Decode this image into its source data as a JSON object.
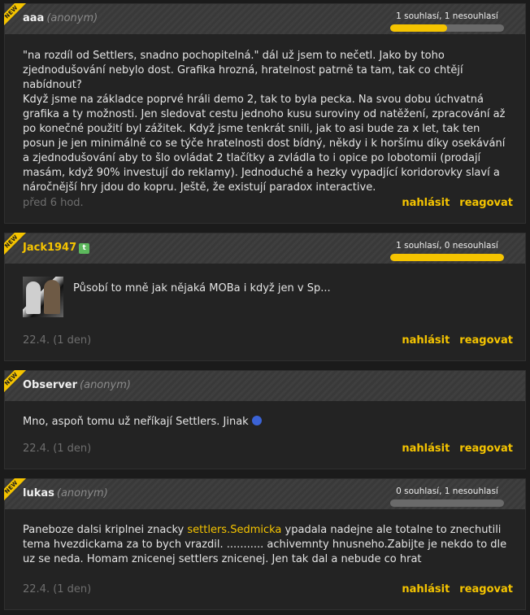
{
  "new_label": "NEW",
  "comments": [
    {
      "name": "aaa",
      "anon": "(anonym)",
      "votes": "1 souhlasí, 1 nesouhlasí",
      "agree_fraction": 0.5,
      "text": "\"na rozdíl od Settlers, snadno pochopitelná.\" dál už jsem to nečetl. Jako by toho zjednodušování nebylo dost. Grafika hrozná, hratelnost patrně ta tam, tak co chtějí nabídnout?\nKdyž jsme na základce poprvé hráli demo 2, tak to byla pecka. Na svou dobu úchvatná grafika a ty možnosti. Jen sledovat cestu jednoho kusu suroviny od natěžení, zpracování až po konečné použití byl zážitek. Když jsme tenkrát snili, jak to asi bude za x let, tak ten posun je jen minimálně co se týče hratelnosti dost bídný, někdy i k horšímu díky osekávání a zjednodušování aby to šlo ovládat 2 tlačítky a zvládla to i opice po lobotomii (prodají masám, když 90% investují do reklamy). Jednoduché a hezky vypadjící koridorovky slaví a náročnější hry jdou do kopru. Ještě, že existují paradox interactive.",
      "date": "před 6 hod.",
      "report": "nahlásit",
      "reply": "reagovat"
    },
    {
      "name": "Jack1947",
      "badge": "t",
      "votes": "1 souhlasí, 0 nesouhlasí",
      "agree_fraction": 1.0,
      "text": "Působí to mně jak nějaká MOBa i když jen v Sp...",
      "avatar_icon": "user-avatar",
      "date": "22.4. (1 den)",
      "report": "nahlásit",
      "reply": "reagovat"
    },
    {
      "name": "Observer",
      "anon": "(anonym)",
      "text": "Mno, aspoň tomu už neříkají Settlers. Jinak",
      "emoji_icon": "sad-face-icon",
      "date": "22.4. (1 den)",
      "report": "nahlásit",
      "reply": "reagovat"
    },
    {
      "name": "lukas",
      "anon": "(anonym)",
      "votes": "0 souhlasí, 1 nesouhlasí",
      "agree_fraction": 0.0,
      "text_before": "Paneboze dalsi kriplnei znacky ",
      "link1": "settlers.",
      "link2": "Sedmicka",
      "text_after": " ypadala nadejne ale totalne to znechutili tema hvezdickama za to bych vrazdil. ........... achivemnty hnusneho.Zabijte je nekdo to dle uz se neda. Homam znicenej settlers znicenej. Jen tak dal a nebude co hrat",
      "date": "22.4. (1 den)",
      "report": "nahlásit",
      "reply": "reagovat"
    }
  ],
  "colors": {
    "accent": "#f5c400",
    "background": "#1b1b1b",
    "header": "#3a3a3a"
  }
}
